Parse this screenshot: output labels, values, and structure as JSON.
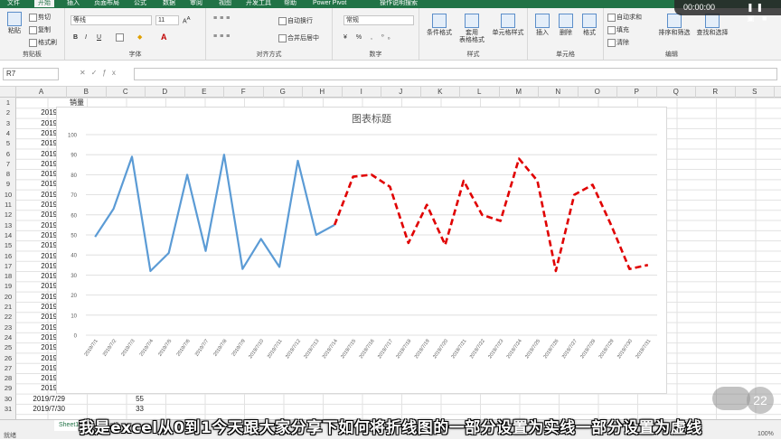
{
  "ribbon_tabs": [
    "文件",
    "开始",
    "插入",
    "页面布局",
    "公式",
    "数据",
    "审阅",
    "视图",
    "开发工具",
    "帮助",
    "Power Pivot",
    "操作说明搜索"
  ],
  "ribbon": {
    "clipboard": {
      "label": "剪贴板",
      "paste": "粘贴",
      "cut": "剪切",
      "copy": "复制",
      "format_painter": "格式刷"
    },
    "font": {
      "label": "字体",
      "font_name": "等线",
      "font_size": "11",
      "bold": "B",
      "italic": "I",
      "underline": "U"
    },
    "alignment": {
      "label": "对齐方式",
      "wrap": "自动换行",
      "merge": "合并后居中"
    },
    "number": {
      "label": "数字",
      "format": "常规"
    },
    "styles": {
      "label": "样式",
      "conditional": "条件格式",
      "table": "套用\n表格格式",
      "cell_styles": "单元格样式"
    },
    "cells": {
      "label": "单元格",
      "insert": "插入",
      "delete": "删除",
      "format": "格式"
    },
    "editing": {
      "label": "编辑",
      "autosum": "自动求和",
      "fill": "填充",
      "clear": "清除",
      "sort": "排序和筛选",
      "find": "查找和选择"
    }
  },
  "formula_bar": {
    "name_box": "R7",
    "value": ""
  },
  "columns": [
    "A",
    "B",
    "C",
    "D",
    "E",
    "F",
    "G",
    "H",
    "I",
    "J",
    "K",
    "L",
    "M",
    "N",
    "O",
    "P",
    "Q",
    "R",
    "S"
  ],
  "rows": [
    "1",
    "2",
    "3",
    "4",
    "5",
    "6",
    "7",
    "8",
    "9",
    "10",
    "11",
    "12",
    "13",
    "14",
    "15",
    "16",
    "17",
    "18",
    "19",
    "20",
    "21",
    "22",
    "23",
    "24",
    "25",
    "26",
    "27",
    "28",
    "29",
    "30",
    "31"
  ],
  "header_b1": "销量",
  "col_a_partial": [
    "2019/7/",
    "2019/7/",
    "2019/7/",
    "2019/7/",
    "2019/7/",
    "2019/7/",
    "2019/7/",
    "2019/7/",
    "2019/7/",
    "2019/7/",
    "2019/7/",
    "2019/7/",
    "2019/7/",
    "2019/7/",
    "2019/7/",
    "2019/7/",
    "2019/7/",
    "2019/7/",
    "2019/7/",
    "2019/7/",
    "2019/7/",
    "2019/7/",
    "2019/7/",
    "2019/7/",
    "2019/7/",
    "2019/7/",
    "2019/7/",
    "2019/7/"
  ],
  "visible_rows": [
    {
      "date": "2019/7/29",
      "value": "55"
    },
    {
      "date": "2019/7/30",
      "value": "33"
    }
  ],
  "sheet_tabs": [
    "Sheet1",
    "Sheet2"
  ],
  "status": {
    "ready": "就绪",
    "zoom": "100%"
  },
  "player": {
    "time": "00:00:00",
    "controls": "❚❚ ▣ ■"
  },
  "badge": "22",
  "subtitle": "我是excel从0到1今天跟大家分享下如何将折线图的一部分设置为实线一部分设置为虚线",
  "colors": {
    "excel_green": "#217346",
    "solid_series": "#5b9bd5",
    "dashed_series": "#e00000"
  },
  "chart_data": {
    "type": "line",
    "title": "图表标题",
    "ylim": [
      0,
      100
    ],
    "yticks": [
      "0",
      "10",
      "20",
      "30",
      "40",
      "50",
      "60",
      "70",
      "80",
      "90",
      "100"
    ],
    "categories": [
      "2019/7/1",
      "2019/7/2",
      "2019/7/3",
      "2019/7/4",
      "2019/7/5",
      "2019/7/6",
      "2019/7/7",
      "2019/7/8",
      "2019/7/9",
      "2019/7/10",
      "2019/7/11",
      "2019/7/12",
      "2019/7/13",
      "2019/7/14",
      "2019/7/15",
      "2019/7/16",
      "2019/7/17",
      "2019/7/18",
      "2019/7/19",
      "2019/7/20",
      "2019/7/21",
      "2019/7/22",
      "2019/7/23",
      "2019/7/24",
      "2019/7/25",
      "2019/7/26",
      "2019/7/27",
      "2019/7/28",
      "2019/7/29",
      "2019/7/30",
      "2019/7/31"
    ],
    "grid": true,
    "series": [
      {
        "style": "solid",
        "color": "#5b9bd5",
        "values": [
          49,
          63,
          89,
          32,
          41,
          80,
          42,
          90,
          33,
          48,
          34,
          87,
          50,
          55,
          null,
          null,
          null,
          null,
          null,
          null,
          null,
          null,
          null,
          null,
          null,
          null,
          null,
          null,
          null,
          null,
          null
        ]
      },
      {
        "style": "dashed",
        "color": "#e00000",
        "values": [
          null,
          null,
          null,
          null,
          null,
          null,
          null,
          null,
          null,
          null,
          null,
          null,
          null,
          55,
          79,
          80,
          74,
          46,
          65,
          45,
          77,
          60,
          57,
          88,
          77,
          32,
          70,
          75,
          55,
          33,
          35
        ]
      }
    ]
  }
}
